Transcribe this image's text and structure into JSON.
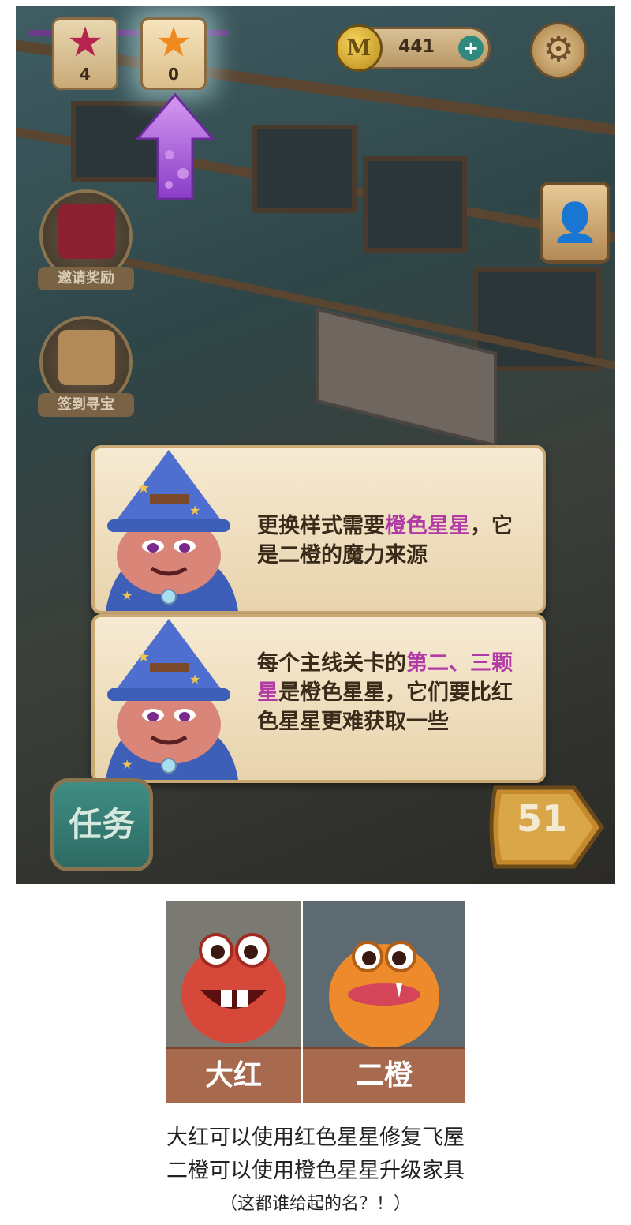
{
  "hud": {
    "red_stars": "4",
    "orange_stars": "0",
    "coins": "441",
    "coin_plus": "+",
    "coin_icon_glyph": "M",
    "icons": [
      "red-star-icon",
      "orange-star-icon",
      "gold-coin-icon",
      "plus-icon",
      "gear-icon",
      "contact-book-icon",
      "up-arrow-icon"
    ]
  },
  "side_buttons": {
    "invite_reward": "邀请奖励",
    "checkin_treasure": "签到寻宝"
  },
  "dialogs": [
    {
      "before": "更换样式需要",
      "highlight": "橙色星星",
      "after": "，它是二橙的魔力来源"
    },
    {
      "before": "每个主线关卡的",
      "highlight": "第二、三颗星",
      "after": "是橙色星星，它们要比红色星星更难获取一些"
    }
  ],
  "bottom_bar": {
    "task_label": "任务",
    "level_number": "51"
  },
  "characters": [
    {
      "name": "大红",
      "color": "#d6493a"
    },
    {
      "name": "二橙",
      "color": "#ec8a2c"
    }
  ],
  "caption": {
    "line1": "大红可以使用红色星星修复飞屋",
    "line2": "二橙可以使用橙色星星升级家具",
    "line3": "（这都谁给起的名？！）"
  },
  "colors": {
    "highlight": "#b23aa6",
    "dialog_bg": "#f6ead2",
    "task_green": "#2d6b63"
  }
}
